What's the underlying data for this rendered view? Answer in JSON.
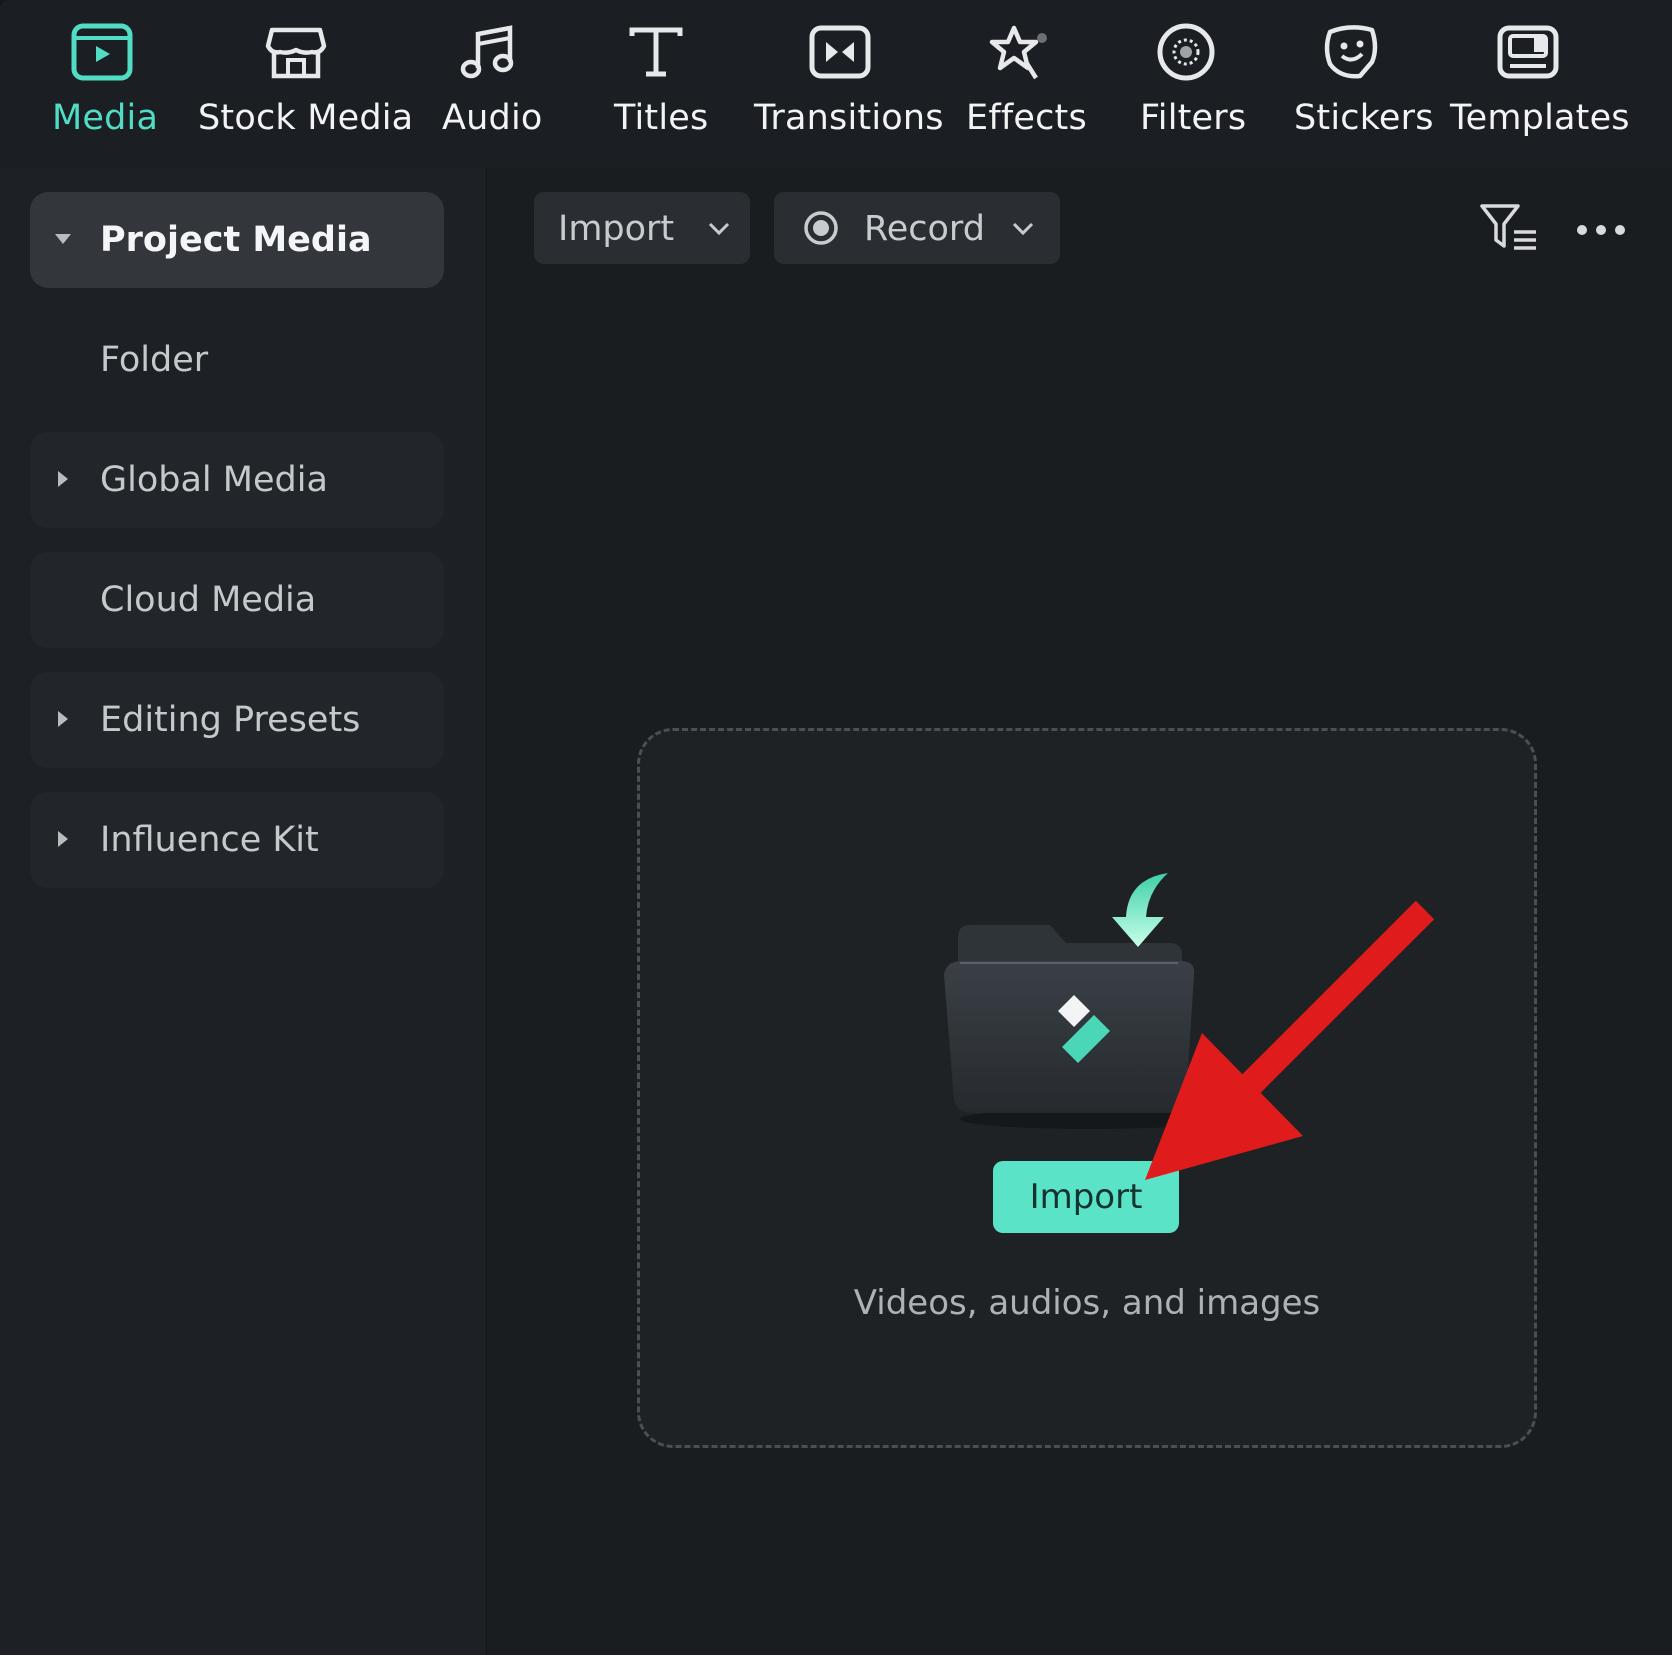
{
  "tabs": [
    {
      "label": "Media",
      "icon": "media-icon",
      "active": true
    },
    {
      "label": "Stock Media",
      "icon": "store-icon"
    },
    {
      "label": "Audio",
      "icon": "music-note-icon"
    },
    {
      "label": "Titles",
      "icon": "text-t-icon"
    },
    {
      "label": "Transitions",
      "icon": "transition-icon"
    },
    {
      "label": "Effects",
      "icon": "sparkle-icon"
    },
    {
      "label": "Filters",
      "icon": "filter-circle-icon"
    },
    {
      "label": "Stickers",
      "icon": "sticker-face-icon"
    },
    {
      "label": "Templates",
      "icon": "template-icon"
    }
  ],
  "sidebar": {
    "items": [
      {
        "label": "Project Media",
        "expanded": true,
        "selected": true
      },
      {
        "label": "Folder"
      },
      {
        "label": "Global Media"
      },
      {
        "label": "Cloud Media"
      },
      {
        "label": "Editing Presets"
      },
      {
        "label": "Influence Kit"
      }
    ]
  },
  "toolbar": {
    "import_label": "Import",
    "record_label": "Record"
  },
  "dropzone": {
    "button_label": "Import",
    "hint": "Videos, audios, and images"
  },
  "colors": {
    "accent": "#51dcc5",
    "import_button": "#5be3c8",
    "annotation_arrow": "#e01b1b"
  }
}
